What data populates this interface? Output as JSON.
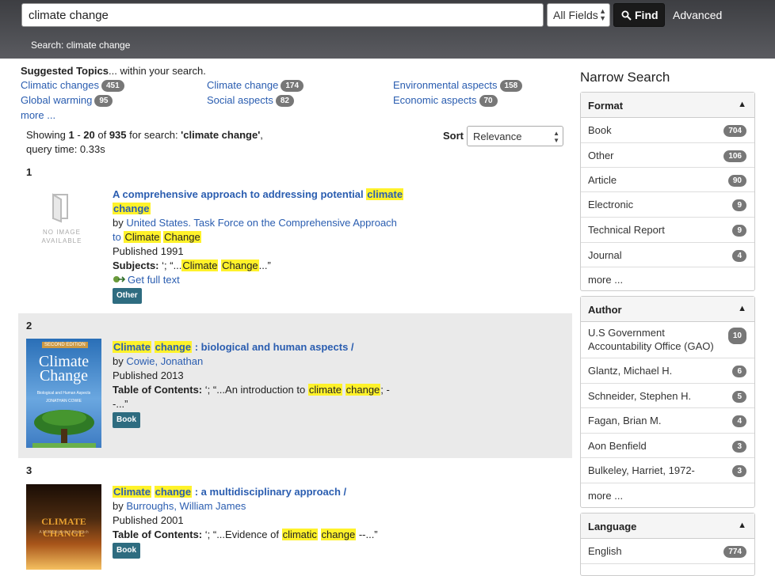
{
  "header": {
    "search_value": "climate change",
    "field_select": "All Fields",
    "find_label": "Find",
    "advanced_label": "Advanced",
    "crumb": "Search: climate change"
  },
  "suggested": {
    "title_bold": "Suggested Topics",
    "title_rest": "... within your search.",
    "topics": [
      {
        "label": "Climatic changes",
        "count": "451"
      },
      {
        "label": "Climate change",
        "count": "174"
      },
      {
        "label": "Environmental aspects",
        "count": "158"
      },
      {
        "label": "Global warming",
        "count": "95"
      },
      {
        "label": "Social aspects",
        "count": "82"
      },
      {
        "label": "Economic aspects",
        "count": "70"
      }
    ],
    "more": "more ..."
  },
  "results_info": {
    "prefix": "Showing ",
    "from": "1",
    "sep1": " - ",
    "to": "20",
    "of": " of ",
    "total": "935",
    "mid": " for search: ",
    "query": "'climate change'",
    "suffix": ",",
    "time": "query time: 0.33s"
  },
  "sort": {
    "label": "Sort",
    "value": "Relevance"
  },
  "results": [
    {
      "num": "1",
      "noimage": "NO IMAGE AVAILABLE",
      "title": "A comprehensive approach to addressing potential ",
      "title_hl1": "climate",
      "title_hl2": "change",
      "by": "by ",
      "author": "United States. Task Force on the Comprehensive Approach",
      "author2": "to ",
      "author_hl1": "Climate",
      "author_hl2": "Change",
      "published": "Published 1991",
      "subjects_label": "Subjects:",
      "subjects_pre": " ‘; “...",
      "subjects_hl1": "Climate",
      "subjects_hl2": "Change",
      "subjects_post": "...”",
      "fulltext": "Get full text",
      "format": "Other"
    },
    {
      "num": "2",
      "title_hl1": "Climate",
      "title_hl2": "change",
      "title": " : biological and human aspects /",
      "by": "by ",
      "author": "Cowie, Jonathan",
      "published": "Published 2013",
      "toc_label": "Table of Contents:",
      "toc_pre": " ‘; “...An introduction to ",
      "toc_hl1": "climate",
      "toc_hl2": "change",
      "toc_post": "; -",
      "toc_post2": "-...”",
      "format": "Book",
      "cover_edition": "SECOND EDITION",
      "cover_title": "Climate Change",
      "cover_sub": "Biological and Human Aspects",
      "cover_author": "JONATHAN COWIE"
    },
    {
      "num": "3",
      "title_hl1": "Climate",
      "title_hl2": "change",
      "title": " : a multidisciplinary approach /",
      "by": "by ",
      "author": "Burroughs, William James",
      "published": "Published 2001",
      "toc_label": "Table of Contents:",
      "toc_pre": " ‘; “...Evidence of ",
      "toc_hl1": "climatic",
      "toc_hl2": "change",
      "toc_post": " --...”",
      "format": "Book",
      "cover_title": "CLIMATE CHANGE",
      "cover_sub": "A Multidisciplinary Approach"
    }
  ],
  "sidebar": {
    "title": "Narrow Search",
    "format": {
      "title": "Format",
      "items": [
        {
          "label": "Book",
          "count": "704"
        },
        {
          "label": "Other",
          "count": "106"
        },
        {
          "label": "Article",
          "count": "90"
        },
        {
          "label": "Electronic",
          "count": "9"
        },
        {
          "label": "Technical Report",
          "count": "9"
        },
        {
          "label": "Journal",
          "count": "4"
        }
      ],
      "more": "more ..."
    },
    "author": {
      "title": "Author",
      "items": [
        {
          "label": "U.S Government Accountability Office (GAO)",
          "count": "10"
        },
        {
          "label": "Glantz, Michael H.",
          "count": "6"
        },
        {
          "label": "Schneider, Stephen H.",
          "count": "5"
        },
        {
          "label": "Fagan, Brian M.",
          "count": "4"
        },
        {
          "label": "Aon Benfield",
          "count": "3"
        },
        {
          "label": "Bulkeley, Harriet, 1972-",
          "count": "3"
        }
      ],
      "more": "more ..."
    },
    "language": {
      "title": "Language",
      "items": [
        {
          "label": "English",
          "count": "774"
        }
      ]
    }
  }
}
